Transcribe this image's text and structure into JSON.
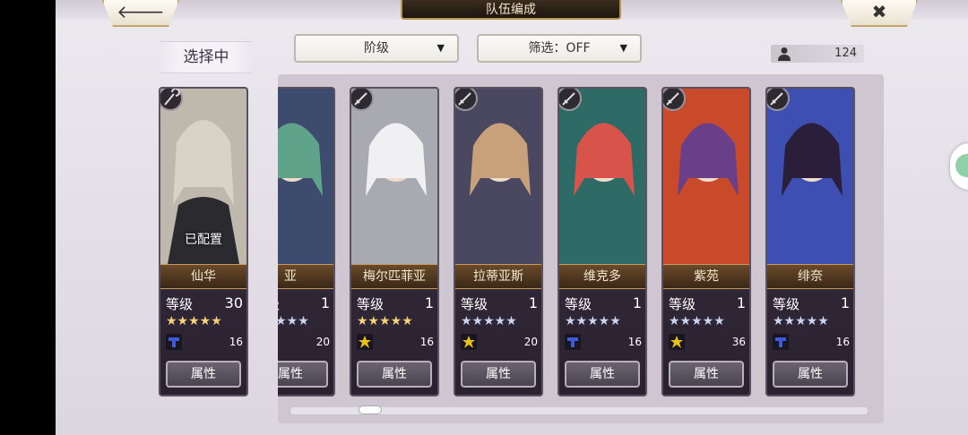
{
  "header": {
    "title": "队伍编成",
    "back_icon": "🡐",
    "close_icon": "✖"
  },
  "selected_label": "选择中",
  "sort_dropdown": {
    "label": "阶级",
    "arrow": "▼"
  },
  "filter_dropdown": {
    "label": "筛选：OFF",
    "arrow": "▼"
  },
  "unit_count": "124",
  "selected_unit": {
    "name": "仙华",
    "level_label": "等级",
    "level": "30",
    "stars": "★★★★★",
    "star_color": "gold",
    "cost": "16",
    "attr_button": "属性",
    "equipped_text": "已配置",
    "portrait_colors": [
      "#d9d2c6",
      "#2b2a2e"
    ]
  },
  "units": [
    {
      "name": "亚",
      "level_label": "等级",
      "level": "1",
      "stars": "★★★★★",
      "star_color": "silver",
      "cost": "20",
      "attr_button": "属性",
      "class_color": "#3d5bd8",
      "portrait_colors": [
        "#5fa48a",
        "#3d4b6e"
      ]
    },
    {
      "name": "梅尔匹菲亚",
      "level_label": "等级",
      "level": "1",
      "stars": "★★★★★",
      "star_color": "gold",
      "cost": "16",
      "attr_button": "属性",
      "class_color": "#e8c21c",
      "portrait_colors": [
        "#f0f0f2",
        "#a9a9b2"
      ]
    },
    {
      "name": "拉蒂亚斯",
      "level_label": "等级",
      "level": "1",
      "stars": "★★★★★",
      "star_color": "silver",
      "cost": "20",
      "attr_button": "属性",
      "class_color": "#e8c21c",
      "portrait_colors": [
        "#c8a07a",
        "#4a4860"
      ]
    },
    {
      "name": "维克多",
      "level_label": "等级",
      "level": "1",
      "stars": "★★★★★",
      "star_color": "silver",
      "cost": "16",
      "attr_button": "属性",
      "class_color": "#3d5bd8",
      "portrait_colors": [
        "#d8544a",
        "#2f6b66"
      ]
    },
    {
      "name": "紫苑",
      "level_label": "等级",
      "level": "1",
      "stars": "★★★★★",
      "star_color": "silver",
      "cost": "36",
      "attr_button": "属性",
      "class_color": "#e8c21c",
      "portrait_colors": [
        "#6a3f8a",
        "#c84a2a"
      ]
    },
    {
      "name": "绯奈",
      "level_label": "等级",
      "level": "1",
      "stars": "★★★★★",
      "star_color": "silver",
      "cost": "16",
      "attr_button": "属性",
      "class_color": "#3d5bd8",
      "portrait_colors": [
        "#2a1e3a",
        "#3d4fb0"
      ]
    }
  ]
}
